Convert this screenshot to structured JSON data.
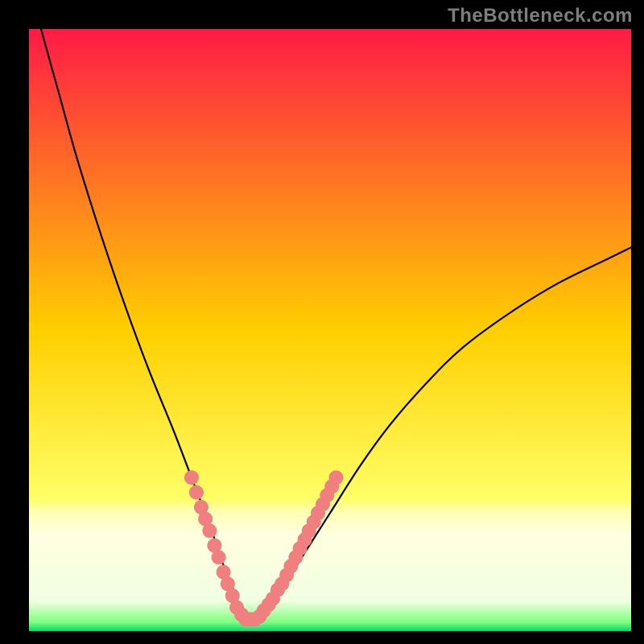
{
  "watermark": "TheBottleneck.com",
  "chart_data": {
    "type": "line",
    "title": "",
    "xlabel": "",
    "ylabel": "",
    "xlim": [
      0,
      100
    ],
    "ylim": [
      -2,
      100
    ],
    "gradient_stops": [
      {
        "offset": 0.0,
        "color": "#ff1a46"
      },
      {
        "offset": 0.5,
        "color": "#ffcf00"
      },
      {
        "offset": 0.78,
        "color": "#ffff66"
      },
      {
        "offset": 0.8,
        "color": "#ffffb0"
      },
      {
        "offset": 0.84,
        "color": "#ffffe0"
      },
      {
        "offset": 0.95,
        "color": "#f0ffe0"
      },
      {
        "offset": 0.985,
        "color": "#80ff80"
      },
      {
        "offset": 1.0,
        "color": "#00d96b"
      }
    ],
    "series": [
      {
        "name": "bottleneck-curve",
        "x": [
          0,
          2,
          5,
          8,
          12,
          16,
          20,
          24,
          27,
          30,
          32,
          34,
          35,
          36,
          37,
          38,
          40,
          42,
          45,
          50,
          55,
          60,
          66,
          72,
          80,
          88,
          96,
          100
        ],
        "y": [
          108,
          100,
          89,
          78,
          65,
          53,
          42,
          32,
          24,
          16,
          10,
          5,
          2,
          0,
          0,
          0,
          2,
          5,
          10,
          18,
          26,
          33,
          40,
          46,
          52,
          57,
          61,
          63
        ]
      }
    ],
    "markers": {
      "name": "highlight-dots",
      "color": "#f08080",
      "radius": 9,
      "points": [
        {
          "x": 27.0,
          "y": 24.0
        },
        {
          "x": 27.8,
          "y": 21.5
        },
        {
          "x": 28.6,
          "y": 19.0
        },
        {
          "x": 29.3,
          "y": 17.0
        },
        {
          "x": 30.0,
          "y": 15.0
        },
        {
          "x": 30.8,
          "y": 12.5
        },
        {
          "x": 31.5,
          "y": 10.5
        },
        {
          "x": 32.3,
          "y": 8.0
        },
        {
          "x": 33.0,
          "y": 6.0
        },
        {
          "x": 33.8,
          "y": 4.0
        },
        {
          "x": 34.5,
          "y": 2.0
        },
        {
          "x": 35.3,
          "y": 0.8
        },
        {
          "x": 36.0,
          "y": 0.0
        },
        {
          "x": 36.8,
          "y": 0.0
        },
        {
          "x": 37.5,
          "y": 0.0
        },
        {
          "x": 38.3,
          "y": 0.5
        },
        {
          "x": 39.0,
          "y": 1.5
        },
        {
          "x": 39.8,
          "y": 2.5
        },
        {
          "x": 40.5,
          "y": 3.5
        },
        {
          "x": 41.3,
          "y": 5.0
        },
        {
          "x": 42.0,
          "y": 6.0
        },
        {
          "x": 42.8,
          "y": 7.5
        },
        {
          "x": 43.5,
          "y": 9.0
        },
        {
          "x": 44.3,
          "y": 10.5
        },
        {
          "x": 45.0,
          "y": 12.0
        },
        {
          "x": 45.8,
          "y": 13.5
        },
        {
          "x": 46.5,
          "y": 15.0
        },
        {
          "x": 47.3,
          "y": 16.5
        },
        {
          "x": 48.0,
          "y": 18.0
        },
        {
          "x": 48.8,
          "y": 19.5
        },
        {
          "x": 49.5,
          "y": 21.0
        },
        {
          "x": 50.3,
          "y": 22.5
        },
        {
          "x": 51.0,
          "y": 24.0
        }
      ]
    }
  }
}
